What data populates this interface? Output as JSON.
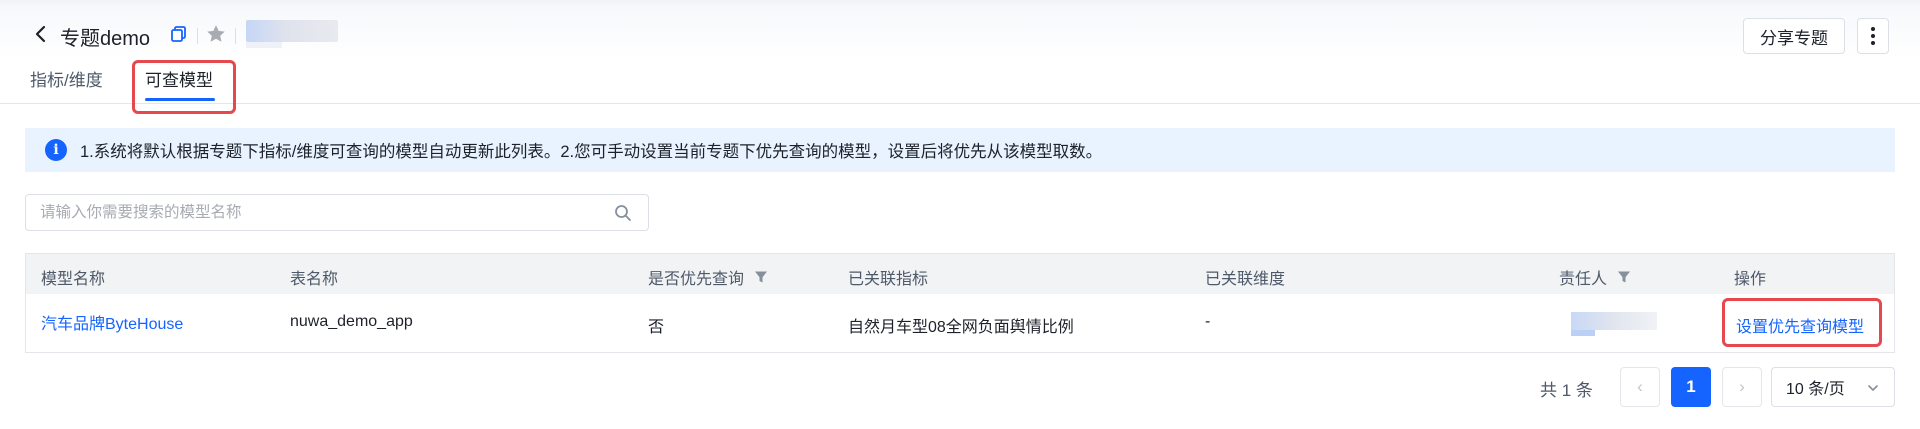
{
  "header": {
    "title": "专题demo",
    "share_label": "分享专题",
    "icons": {
      "back": "chevron-left-icon",
      "copy": "copy-icon",
      "star": "star-icon",
      "more": "more-vertical-icon"
    }
  },
  "tabs": [
    {
      "label": "指标/维度",
      "active": false
    },
    {
      "label": "可查模型",
      "active": true
    }
  ],
  "alert": {
    "icon": "info-icon",
    "icon_glyph": "i",
    "text": "1.系统将默认根据专题下指标/维度可查询的模型自动更新此列表。2.您可手动设置当前专题下优先查询的模型，设置后将优先从该模型取数。"
  },
  "search": {
    "placeholder": "请输入你需要搜索的模型名称",
    "value": ""
  },
  "table": {
    "columns": [
      "模型名称",
      "表名称",
      "是否优先查询",
      "已关联指标",
      "已关联维度",
      "责任人",
      "操作"
    ],
    "rows": [
      {
        "model_name": "汽车品牌ByteHouse",
        "table_name": "nuwa_demo_app",
        "priority": "否",
        "metrics": "自然月车型08全网负面舆情比例",
        "dimensions": "-",
        "action": "设置优先查询模型"
      }
    ]
  },
  "pagination": {
    "total_label": "共 1 条",
    "current_page": "1",
    "prev_glyph": "‹",
    "next_glyph": "›",
    "page_size_label": "10 条/页"
  },
  "colors": {
    "primary": "#1664ff",
    "highlight": "#e5484d",
    "alert_bg": "#e8f3ff"
  }
}
